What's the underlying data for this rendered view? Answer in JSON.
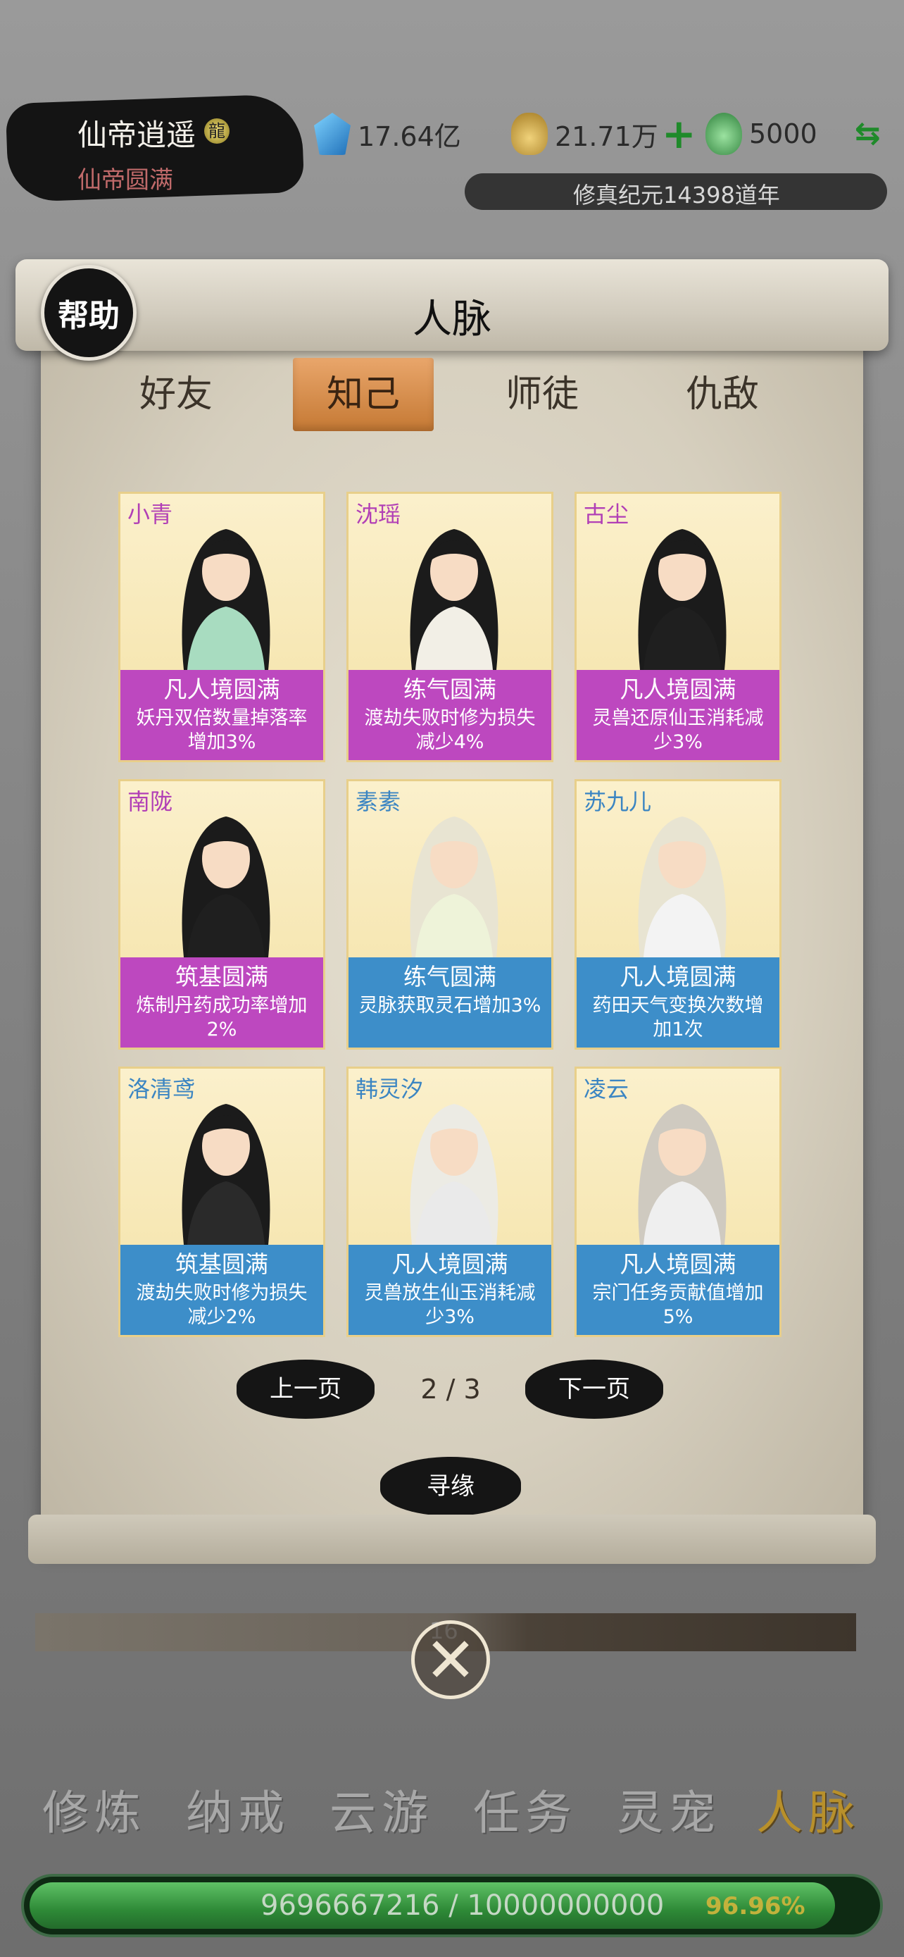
{
  "player": {
    "name": "仙帝逍遥",
    "realm": "仙帝圆满"
  },
  "resources": {
    "spirit_stones": "17.64亿",
    "immortal_jade_bag": "21.71万",
    "jade": "5000",
    "add_symbol": "+",
    "swap_symbol": "⇆"
  },
  "era": "修真纪元14398道年",
  "panel": {
    "help_label": "帮助",
    "title": "人脉",
    "tabs": [
      "好友",
      "知己",
      "师徒",
      "仇敌"
    ],
    "active_tab": "知己"
  },
  "cards": [
    {
      "name": "小青",
      "realm": "凡人境圆满",
      "effect": "妖丹双倍数量掉落率增加3%",
      "band": "purple",
      "name_color": "purple"
    },
    {
      "name": "沈瑶",
      "realm": "练气圆满",
      "effect": "渡劫失败时修为损失减少4%",
      "band": "purple",
      "name_color": "purple"
    },
    {
      "name": "古尘",
      "realm": "凡人境圆满",
      "effect": "灵兽还原仙玉消耗减少3%",
      "band": "purple",
      "name_color": "purple"
    },
    {
      "name": "南陇",
      "realm": "筑基圆满",
      "effect": "炼制丹药成功率增加2%",
      "band": "purple",
      "name_color": "purple"
    },
    {
      "name": "素素",
      "realm": "练气圆满",
      "effect": "灵脉获取灵石增加3%",
      "band": "blue",
      "name_color": "blue"
    },
    {
      "name": "苏九儿",
      "realm": "凡人境圆满",
      "effect": "药田天气变换次数增加1次",
      "band": "blue",
      "name_color": "blue"
    },
    {
      "name": "洛清鸢",
      "realm": "筑基圆满",
      "effect": "渡劫失败时修为损失减少2%",
      "band": "blue",
      "name_color": "blue"
    },
    {
      "name": "韩灵汐",
      "realm": "凡人境圆满",
      "effect": "灵兽放生仙玉消耗减少3%",
      "band": "blue",
      "name_color": "blue"
    },
    {
      "name": "凌云",
      "realm": "凡人境圆满",
      "effect": "宗门任务贡献值增加5%",
      "band": "blue",
      "name_color": "blue"
    }
  ],
  "pagination": {
    "prev_label": "上一页",
    "next_label": "下一页",
    "current": "2 / 3"
  },
  "seek_label": "寻缘",
  "background_bar_number": "16",
  "nav": [
    "修炼",
    "纳戒",
    "云游",
    "任务",
    "灵宠",
    "人脉"
  ],
  "nav_active": "人脉",
  "exp": {
    "text": "9696667216 / 10000000000",
    "percent": "96.96%",
    "fraction": 0.9697
  },
  "colors": {
    "purple_band": "#bd48bf",
    "blue_band": "#3d8ec9",
    "active_tab": "#d58c4b",
    "exp_green": "#2e8a37"
  }
}
